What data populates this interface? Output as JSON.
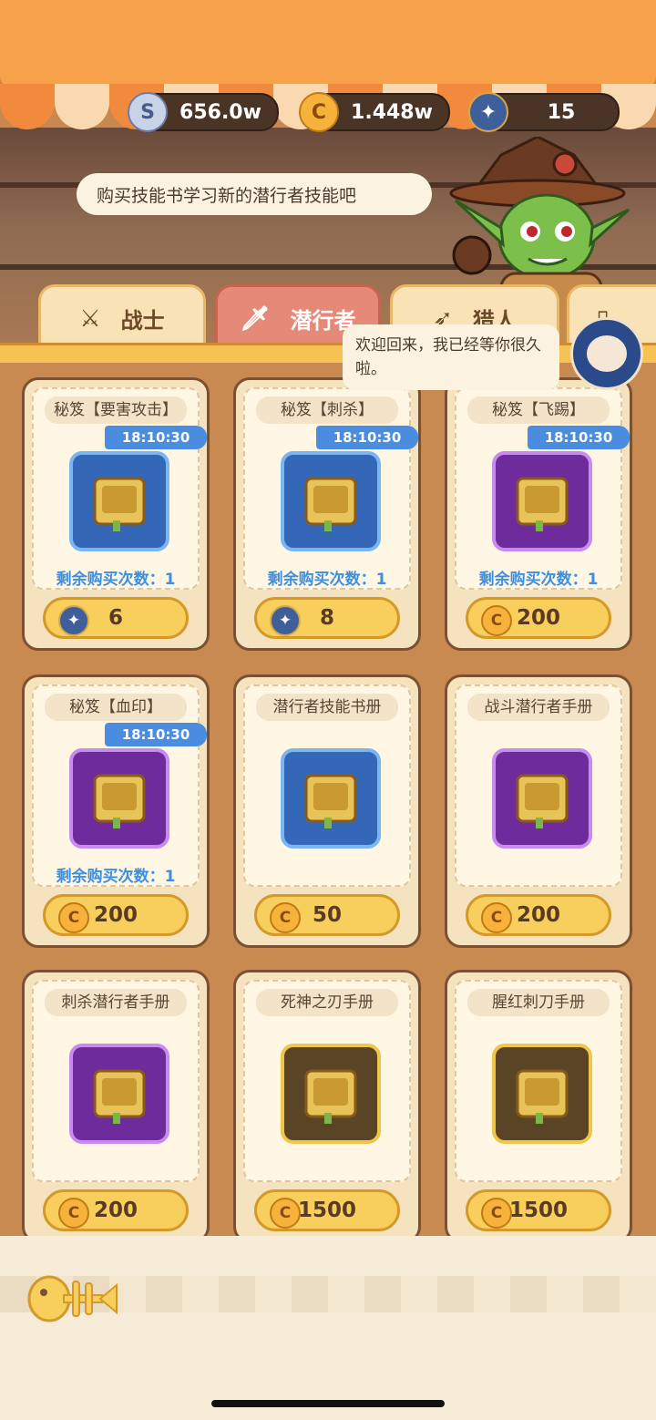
{
  "currencies": {
    "silver": {
      "value": "656.0w",
      "icon": "silver-coin-icon"
    },
    "gold": {
      "value": "1.448w",
      "icon": "gold-coin-icon"
    },
    "gem": {
      "value": "15",
      "icon": "star-gem-icon"
    }
  },
  "npc": {
    "speech": "购买技能书学习新的潜行者技能吧"
  },
  "welcome": {
    "text": "欢迎回来，我已经等你很久啦。"
  },
  "tabs": [
    {
      "label": "战士",
      "icon": "sword-icon",
      "active": false
    },
    {
      "label": "潜行者",
      "icon": "dagger-icon",
      "active": true
    },
    {
      "label": "猎人",
      "icon": "bow-icon",
      "active": false
    },
    {
      "label": "",
      "icon": "scroll-icon",
      "active": false
    }
  ],
  "items": [
    {
      "title": "秘笈【要害攻击】",
      "timer": "18:10:30",
      "frame": "blue",
      "remaining": "剩余购买次数：1",
      "price": "6",
      "currency": "gem"
    },
    {
      "title": "秘笈【刺杀】",
      "timer": "18:10:30",
      "frame": "blue",
      "remaining": "剩余购买次数：1",
      "price": "8",
      "currency": "gem"
    },
    {
      "title": "秘笈【飞踢】",
      "timer": "18:10:30",
      "frame": "purple",
      "remaining": "剩余购买次数：1",
      "price": "200",
      "currency": "coin"
    },
    {
      "title": "秘笈【血印】",
      "timer": "18:10:30",
      "frame": "purple",
      "remaining": "剩余购买次数：1",
      "price": "200",
      "currency": "coin"
    },
    {
      "title": "潜行者技能书册",
      "timer": "",
      "frame": "blue",
      "remaining": "",
      "price": "50",
      "currency": "coin"
    },
    {
      "title": "战斗潜行者手册",
      "timer": "",
      "frame": "purple",
      "remaining": "",
      "price": "200",
      "currency": "coin"
    },
    {
      "title": "刺杀潜行者手册",
      "timer": "",
      "frame": "purple",
      "remaining": "",
      "price": "200",
      "currency": "coin"
    },
    {
      "title": "死神之刃手册",
      "timer": "",
      "frame": "gold",
      "remaining": "",
      "price": "1500",
      "currency": "coin"
    },
    {
      "title": "腥红刺刀手册",
      "timer": "",
      "frame": "gold",
      "remaining": "",
      "price": "1500",
      "currency": "coin"
    }
  ],
  "bottom": {
    "icon": "fish-bone-icon"
  }
}
